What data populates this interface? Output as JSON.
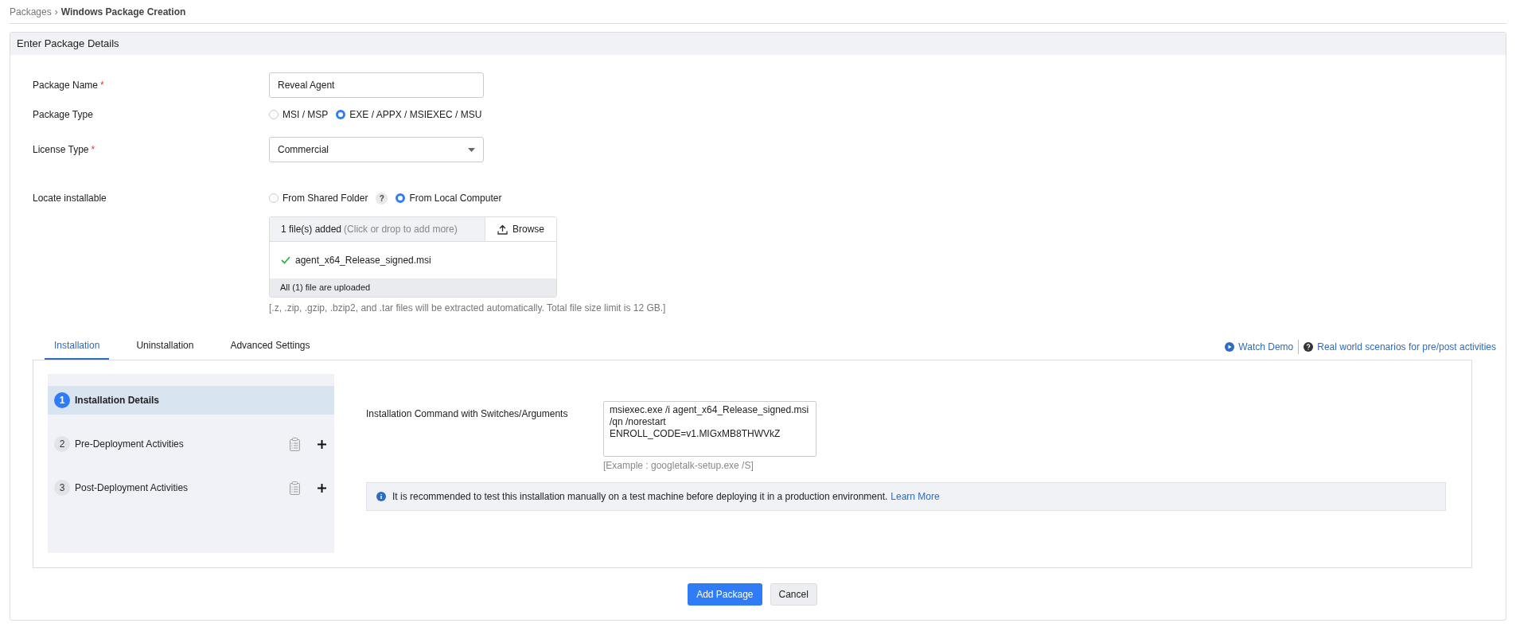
{
  "breadcrumb": {
    "parent": "Packages",
    "separator": "›",
    "current": "Windows Package Creation"
  },
  "panel_title": "Enter Package Details",
  "fields": [
    {
      "kind": "text",
      "label": "Package Name",
      "mark": "*",
      "value": "Reveal Agent"
    },
    {
      "kind": "radio",
      "label": "Package Type",
      "options": [
        {
          "label": "MSI / MSP",
          "selected": false
        },
        {
          "label": "EXE / APPX / MSIEXEC / MSU",
          "selected": true
        }
      ]
    },
    {
      "kind": "select",
      "label": "License Type",
      "mark": "*",
      "value": "Commercial"
    },
    {
      "kind": "radio",
      "label": "Locate installable",
      "help": "?",
      "options": [
        {
          "label": "From Shared Folder",
          "selected": false
        },
        {
          "label": "From Local Computer",
          "selected": true
        }
      ]
    }
  ],
  "upload": {
    "summary": "1 file(s) added",
    "summary_hint": "(Click or drop to add more)",
    "browse": "Browse",
    "files": [
      {
        "name": "agent_x64_Release_signed.msi"
      }
    ],
    "status": "All (1) file are uploaded",
    "note": "[.z, .zip, .gzip, .bzip2, and .tar files will be extracted automatically. Total file size limit is 12 GB.]"
  },
  "tabs": [
    {
      "label": "Installation",
      "selected": true
    },
    {
      "label": "Uninstallation",
      "selected": false
    },
    {
      "label": "Advanced Settings",
      "selected": false
    }
  ],
  "links": [
    {
      "kind": "video",
      "label": "Watch Demo"
    },
    {
      "kind": "help",
      "label": "Real world scenarios for pre/post activities"
    }
  ],
  "steps": [
    {
      "number": "1",
      "label": "Installation Details",
      "selected": true,
      "kind": "main"
    },
    {
      "number": "2",
      "label": "Pre-Deployment Activities",
      "selected": false,
      "kind": "activity"
    },
    {
      "number": "3",
      "label": "Post-Deployment Activities",
      "selected": false,
      "kind": "activity"
    }
  ],
  "command": {
    "label": "Installation Command with Switches/Arguments",
    "value": "msiexec.exe /i agent_x64_Release_signed.msi /qn /norestart ENROLL_CODE=v1.MIGxMB8THWVkZ",
    "example": "[Example : googletalk-setup.exe /S]"
  },
  "info": {
    "text": "It is recommended to test this installation manually on a test machine before deploying it in a production environment.",
    "link": "Learn More"
  },
  "buttons": [
    {
      "kind": "primary",
      "label": "Add Package"
    },
    {
      "kind": "secondary",
      "label": "Cancel"
    }
  ]
}
